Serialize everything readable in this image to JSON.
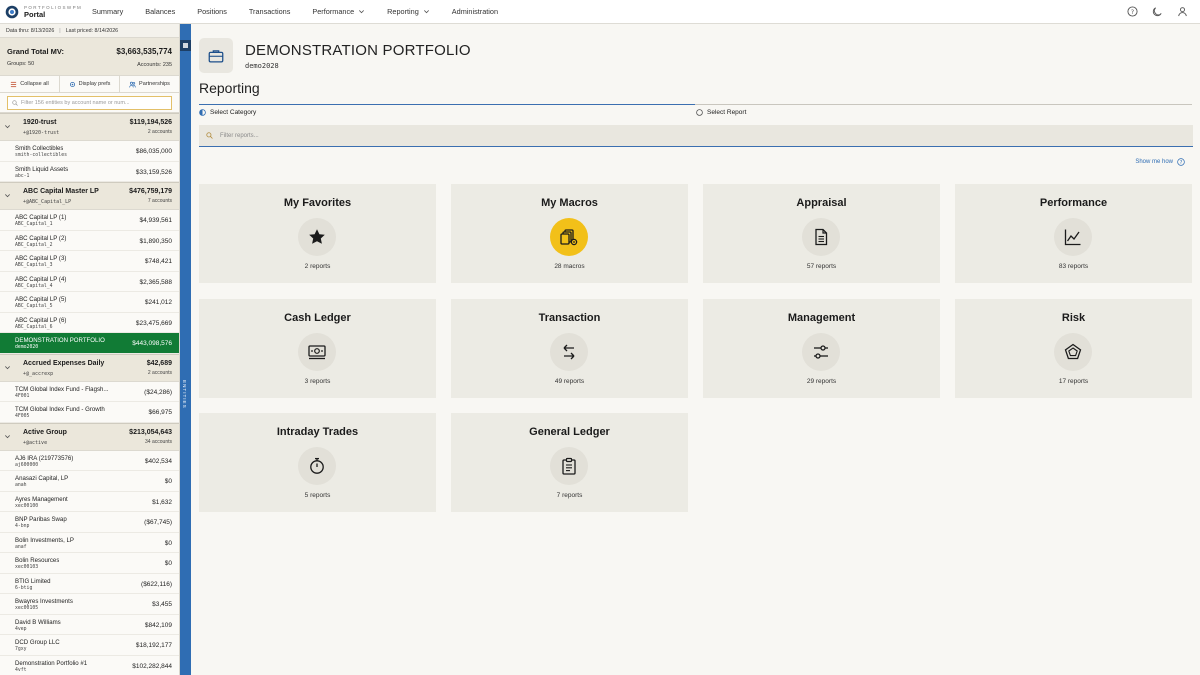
{
  "brand": {
    "small": "PORTFOLIOSWPM",
    "name": "Portal"
  },
  "nav": {
    "items": [
      {
        "label": "Summary",
        "dropdown": false
      },
      {
        "label": "Balances",
        "dropdown": false
      },
      {
        "label": "Positions",
        "dropdown": false
      },
      {
        "label": "Transactions",
        "dropdown": false
      },
      {
        "label": "Performance",
        "dropdown": true
      },
      {
        "label": "Reporting",
        "dropdown": true
      },
      {
        "label": "Administration",
        "dropdown": false
      }
    ],
    "right_icons": [
      "help-icon",
      "moon-icon",
      "user-icon"
    ]
  },
  "sidebar": {
    "data_thru": "Data thru: 8/13/2026",
    "last_priced": "Last priced: 8/14/2026",
    "grand_label": "Grand Total MV:",
    "grand_value": "$3,663,535,774",
    "groups": "Groups: 50",
    "accounts": "Accounts: 235",
    "actions": [
      {
        "label": "Collapse all",
        "icon": "list-icon"
      },
      {
        "label": "Display prefs",
        "icon": "gear-icon"
      },
      {
        "label": "Partnerships",
        "icon": "people-icon"
      }
    ],
    "filter_placeholder": "Filter 156 entities by account name or num...",
    "entities_label": "ENTITIES",
    "groups_list": [
      {
        "name": "1920-trust",
        "code": "+@1920-trust",
        "value": "$119,194,526",
        "count": "2 accounts",
        "rows": [
          {
            "name": "Smith Collectibles",
            "code": "smith-collectibles",
            "value": "$86,035,000"
          },
          {
            "name": "Smith Liquid Assets",
            "code": "abc-1",
            "value": "$33,159,526"
          }
        ]
      },
      {
        "name": "ABC Capital Master LP",
        "code": "+@ABC_Capital_LP",
        "value": "$476,759,179",
        "count": "7 accounts",
        "rows": [
          {
            "name": "ABC Capital LP (1)",
            "code": "ABC_Capital_1",
            "value": "$4,939,561"
          },
          {
            "name": "ABC Capital LP (2)",
            "code": "ABC_Capital_2",
            "value": "$1,890,350"
          },
          {
            "name": "ABC Capital LP (3)",
            "code": "ABC_Capital_3",
            "value": "$748,421"
          },
          {
            "name": "ABC Capital LP (4)",
            "code": "ABC_Capital_4",
            "value": "$2,365,588"
          },
          {
            "name": "ABC Capital LP (5)",
            "code": "ABC_Capital_5",
            "value": "$241,012"
          },
          {
            "name": "ABC Capital LP (6)",
            "code": "ABC_Capital_6",
            "value": "$23,475,669"
          },
          {
            "name": "DEMONSTRATION PORTFOLIO",
            "code": "demo2020",
            "value": "$443,098,576",
            "selected": true
          }
        ]
      },
      {
        "name": "Accrued Expenses Daily",
        "code": "+@_accrexp",
        "value": "$42,689",
        "count": "2 accounts",
        "rows": [
          {
            "name": "TCM Global Index Fund - Flagsh...",
            "code": "4F001",
            "value": "($24,286)"
          },
          {
            "name": "TCM Global Index Fund - Growth",
            "code": "4F005",
            "value": "$66,975"
          }
        ]
      },
      {
        "name": "Active Group",
        "code": "+@active",
        "value": "$213,054,643",
        "count": "34 accounts",
        "rows": [
          {
            "name": "AJ6 IRA (219773576)",
            "code": "aj600000",
            "value": "$402,534"
          },
          {
            "name": "Anasazi Capital, LP",
            "code": "anah",
            "value": "$0"
          },
          {
            "name": "Ayres Management",
            "code": "xec00100",
            "value": "$1,632"
          },
          {
            "name": "BNP Paribas Swap",
            "code": "4-bnp",
            "value": "($67,745)"
          },
          {
            "name": "Bolin Investments, LP",
            "code": "anaf",
            "value": "$0"
          },
          {
            "name": "Bolin Resources",
            "code": "xec00103",
            "value": "$0"
          },
          {
            "name": "BTIG Limited",
            "code": "6-btig",
            "value": "($622,116)"
          },
          {
            "name": "Bwayres Investments",
            "code": "xec00105",
            "value": "$3,455"
          },
          {
            "name": "David B Williams",
            "code": "4vep",
            "value": "$842,109"
          },
          {
            "name": "DCD Group LLC",
            "code": "7gxy",
            "value": "$18,192,177"
          },
          {
            "name": "Demonstration Portfolio #1",
            "code": "4vft",
            "value": "$102,282,844"
          }
        ]
      }
    ]
  },
  "main": {
    "portfolio_title": "DEMONSTRATION PORTFOLIO",
    "portfolio_code": "demo2028",
    "section_title": "Reporting",
    "step1": "Select Category",
    "step2": "Select Report",
    "filter_placeholder": "Filter reports...",
    "show_me": "Show me how",
    "cards": [
      {
        "title": "My Favorites",
        "icon": "star-icon",
        "count": "2 reports",
        "highlight": false
      },
      {
        "title": "My Macros",
        "icon": "macros-icon",
        "count": "28 macros",
        "highlight": true
      },
      {
        "title": "Appraisal",
        "icon": "document-icon",
        "count": "57 reports",
        "highlight": false
      },
      {
        "title": "Performance",
        "icon": "line-chart-icon",
        "count": "83 reports",
        "highlight": false
      },
      {
        "title": "Cash Ledger",
        "icon": "cash-icon",
        "count": "3 reports",
        "highlight": false
      },
      {
        "title": "Transaction",
        "icon": "swap-arrows-icon",
        "count": "49 reports",
        "highlight": false
      },
      {
        "title": "Management",
        "icon": "sliders-icon",
        "count": "29 reports",
        "highlight": false
      },
      {
        "title": "Risk",
        "icon": "pentagon-icon",
        "count": "17 reports",
        "highlight": false
      },
      {
        "title": "Intraday Trades",
        "icon": "stopwatch-icon",
        "count": "5 reports",
        "highlight": false
      },
      {
        "title": "General Ledger",
        "icon": "clipboard-icon",
        "count": "7 reports",
        "highlight": false
      }
    ]
  },
  "colors": {
    "accent_blue": "#2f6db3",
    "selected_green": "#117b35",
    "macro_yellow": "#f2c019",
    "card_bg": "#ecebe4"
  }
}
